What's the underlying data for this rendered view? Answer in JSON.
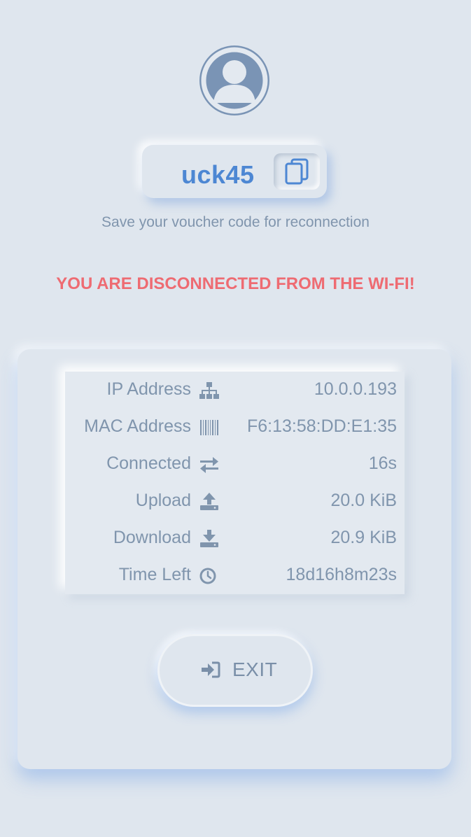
{
  "profile": {
    "avatar_icon": "user-avatar-icon"
  },
  "voucher": {
    "code": "uck45",
    "copy_icon": "copy-icon",
    "note": "Save your voucher code for reconnection"
  },
  "status": {
    "message": "YOU ARE DISCONNECTED FROM THE WI-FI!",
    "color": "#ee6b72"
  },
  "session": {
    "rows": [
      {
        "label": "IP Address",
        "icon": "network-icon",
        "value": "10.0.0.193"
      },
      {
        "label": "MAC Address",
        "icon": "barcode-icon",
        "value": "F6:13:58:DD:E1:35"
      },
      {
        "label": "Connected",
        "icon": "exchange-icon",
        "value": "16s"
      },
      {
        "label": "Upload",
        "icon": "upload-icon",
        "value": "20.0 KiB"
      },
      {
        "label": "Download",
        "icon": "download-icon",
        "value": "20.9 KiB"
      },
      {
        "label": "Time Left",
        "icon": "clock-icon",
        "value": "18d16h8m23s"
      }
    ]
  },
  "exit": {
    "label": "EXIT",
    "icon": "sign-in-icon"
  },
  "colors": {
    "background": "#dfe6ee",
    "accent": "#4d87d3",
    "text": "#8095ad"
  }
}
